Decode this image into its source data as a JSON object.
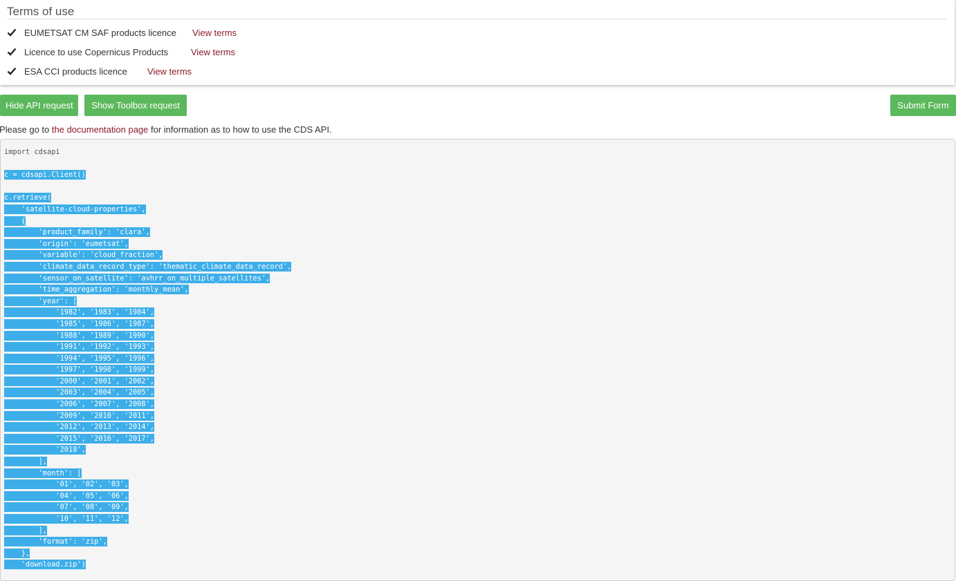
{
  "terms": {
    "title": "Terms of use",
    "licences": [
      {
        "name": "EUMETSAT CM SAF products licence",
        "link": "View terms"
      },
      {
        "name": "Licence to use Copernicus Products",
        "link": "View terms"
      },
      {
        "name": "ESA CCI products licence",
        "link": "View terms"
      }
    ]
  },
  "buttons": {
    "hide_api": "Hide API request",
    "show_toolbox": "Show Toolbox request",
    "submit": "Submit Form"
  },
  "doc_line": {
    "prefix": "Please go to ",
    "link": "the documentation page",
    "suffix": " for information as to how to use the CDS API."
  },
  "colors": {
    "button_green": "#5cb85c",
    "link_red": "#8b1a2b",
    "selection_blue": "#3daee9"
  },
  "code": {
    "lines": [
      {
        "text": "import cdsapi",
        "selected": false
      },
      {
        "text": "",
        "selected": false
      },
      {
        "text": "c = cdsapi.Client()",
        "selected": true
      },
      {
        "text": "",
        "selected": false
      },
      {
        "text": "c.retrieve(",
        "selected": true
      },
      {
        "text": "    'satellite-cloud-properties',",
        "selected": true
      },
      {
        "text": "    {",
        "selected": true
      },
      {
        "text": "        'product_family': 'clara',",
        "selected": true
      },
      {
        "text": "        'origin': 'eumetsat',",
        "selected": true
      },
      {
        "text": "        'variable': 'cloud_fraction',",
        "selected": true
      },
      {
        "text": "        'climate_data_record_type': 'thematic_climate_data_record',",
        "selected": true
      },
      {
        "text": "        'sensor_on_satellite': 'avhrr_on_multiple_satellites',",
        "selected": true
      },
      {
        "text": "        'time_aggregation': 'monthly_mean',",
        "selected": true
      },
      {
        "text": "        'year': [",
        "selected": true
      },
      {
        "text": "            '1982', '1983', '1984',",
        "selected": true
      },
      {
        "text": "            '1985', '1986', '1987',",
        "selected": true
      },
      {
        "text": "            '1988', '1989', '1990',",
        "selected": true
      },
      {
        "text": "            '1991', '1992', '1993',",
        "selected": true
      },
      {
        "text": "            '1994', '1995', '1996',",
        "selected": true
      },
      {
        "text": "            '1997', '1998', '1999',",
        "selected": true
      },
      {
        "text": "            '2000', '2001', '2002',",
        "selected": true
      },
      {
        "text": "            '2003', '2004', '2005',",
        "selected": true
      },
      {
        "text": "            '2006', '2007', '2008',",
        "selected": true
      },
      {
        "text": "            '2009', '2010', '2011',",
        "selected": true
      },
      {
        "text": "            '2012', '2013', '2014',",
        "selected": true
      },
      {
        "text": "            '2015', '2016', '2017',",
        "selected": true
      },
      {
        "text": "            '2018',",
        "selected": true
      },
      {
        "text": "        ],",
        "selected": true
      },
      {
        "text": "        'month': [",
        "selected": true
      },
      {
        "text": "            '01', '02', '03',",
        "selected": true
      },
      {
        "text": "            '04', '05', '06',",
        "selected": true
      },
      {
        "text": "            '07', '08', '09',",
        "selected": true
      },
      {
        "text": "            '10', '11', '12',",
        "selected": true
      },
      {
        "text": "        ],",
        "selected": true
      },
      {
        "text": "        'format': 'zip',",
        "selected": true
      },
      {
        "text": "    },",
        "selected": true
      },
      {
        "text": "    'download.zip')",
        "selected": true
      }
    ]
  }
}
